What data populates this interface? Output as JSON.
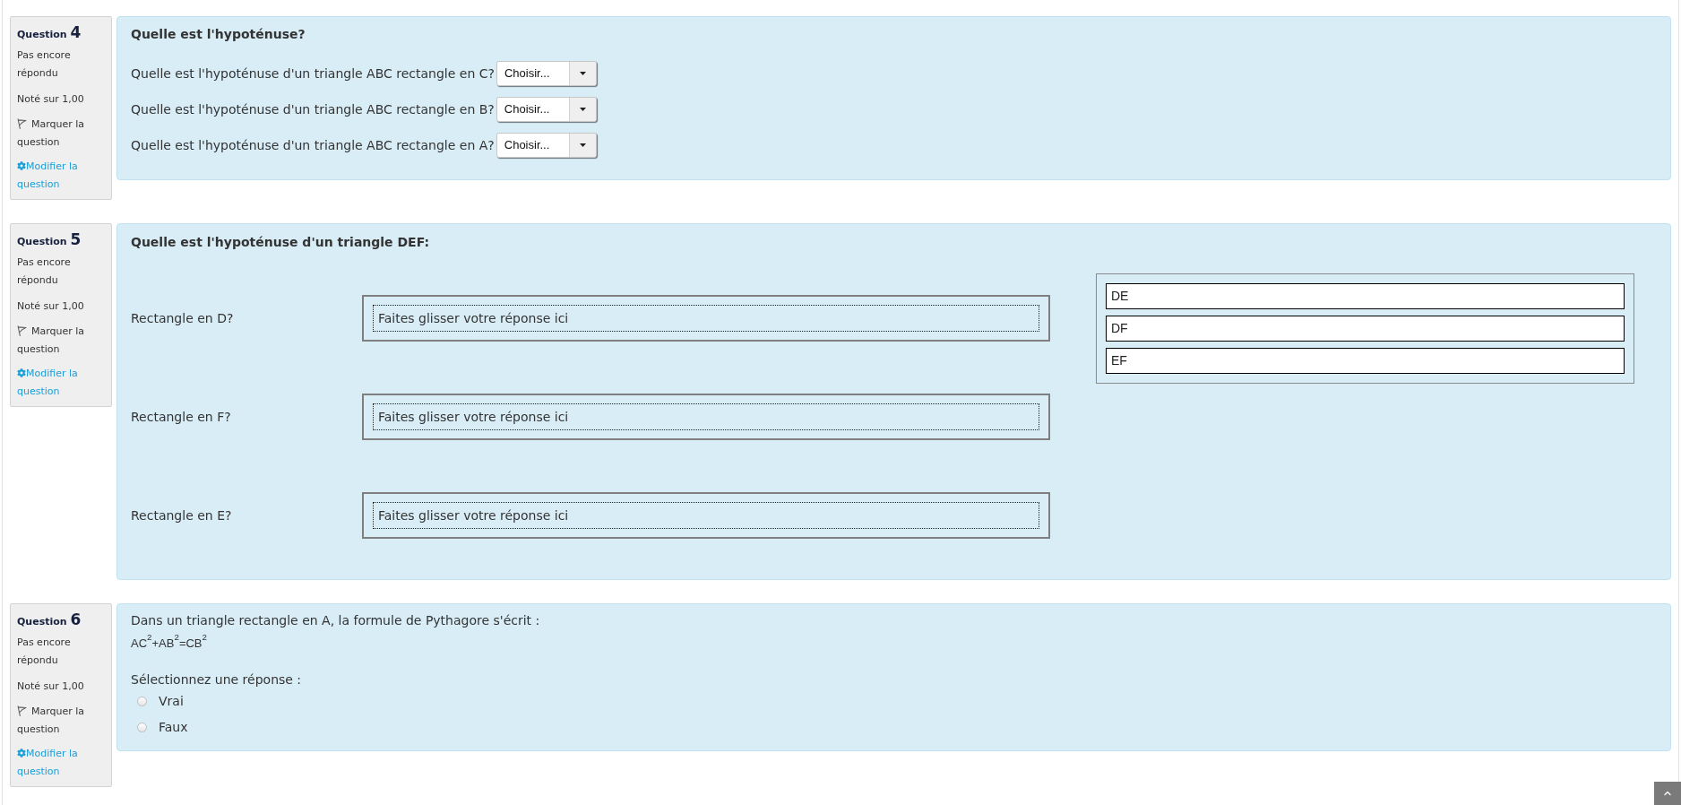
{
  "questions": [
    {
      "kind": "select",
      "label": "Question",
      "number": "4",
      "state": "Pas encore répondu",
      "grade": "Noté sur 1,00",
      "flag_label": "Marquer la question",
      "edit_link": "Modifier la question",
      "title": "Quelle est l'hypoténuse?",
      "rows": [
        {
          "prompt": "Quelle est l'hypoténuse d'un triangle ABC rectangle en C?",
          "value": "Choisir..."
        },
        {
          "prompt": "Quelle est l'hypoténuse d'un triangle ABC rectangle en B?",
          "value": "Choisir..."
        },
        {
          "prompt": "Quelle est l'hypoténuse d'un triangle ABC rectangle en A?",
          "value": "Choisir..."
        }
      ]
    },
    {
      "kind": "drag",
      "label": "Question",
      "number": "5",
      "state": "Pas encore répondu",
      "grade": "Noté sur 1,00",
      "flag_label": "Marquer la question",
      "edit_link": "Modifier la question",
      "title": "Quelle est l'hypoténuse d'un triangle DEF:",
      "rows": [
        {
          "prompt": "Rectangle en D?",
          "placeholder": "Faites glisser votre réponse ici"
        },
        {
          "prompt": "Rectangle en F?",
          "placeholder": "Faites glisser votre réponse ici"
        },
        {
          "prompt": "Rectangle en E?",
          "placeholder": "Faites glisser votre réponse ici"
        }
      ],
      "choices": [
        "DE",
        "DF",
        "EF"
      ]
    },
    {
      "kind": "multichoice",
      "label": "Question",
      "number": "6",
      "state": "Pas encore répondu",
      "grade": "Noté sur 1,00",
      "flag_label": "Marquer la question",
      "edit_link": "Modifier la question",
      "text": "Dans un triangle rectangle en A, la formule de Pythagore s'écrit :",
      "formula": "AC$^{2}$+AB$^{2}$=CB$^{2}$",
      "prompt": "Sélectionnez une réponse :",
      "options": [
        {
          "label": "Vrai",
          "selected": false
        },
        {
          "label": "Faux",
          "selected": false
        }
      ]
    }
  ]
}
